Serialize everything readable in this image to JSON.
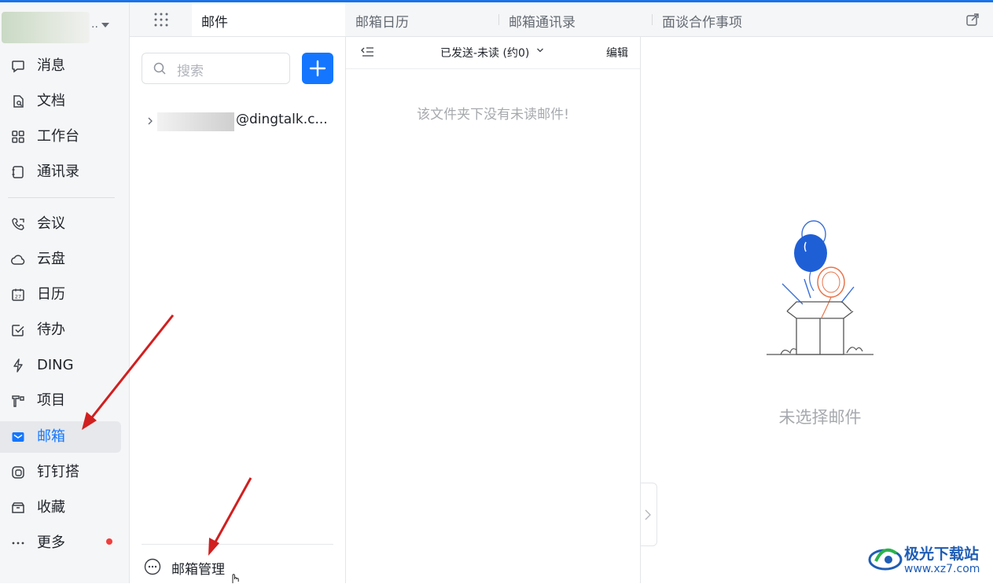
{
  "sidebar": {
    "profile_suffix": "..",
    "items": [
      {
        "label": "消息",
        "icon": "chat-bubble-icon"
      },
      {
        "label": "文档",
        "icon": "document-icon"
      },
      {
        "label": "工作台",
        "icon": "grid-icon"
      },
      {
        "label": "通讯录",
        "icon": "contacts-book-icon"
      },
      {
        "label": "会议",
        "icon": "phone-video-icon"
      },
      {
        "label": "云盘",
        "icon": "cloud-icon"
      },
      {
        "label": "日历",
        "icon": "calendar-icon",
        "day": "27"
      },
      {
        "label": "待办",
        "icon": "checkbox-icon"
      },
      {
        "label": "DING",
        "icon": "lightning-icon"
      },
      {
        "label": "项目",
        "icon": "project-icon"
      },
      {
        "label": "邮箱",
        "icon": "mail-icon",
        "active": true
      },
      {
        "label": "钉钉搭",
        "icon": "app-builder-icon"
      },
      {
        "label": "收藏",
        "icon": "box-icon"
      },
      {
        "label": "更多",
        "icon": "more-dots-icon",
        "badge": "red-dot"
      }
    ]
  },
  "tabs": [
    {
      "label": "邮件",
      "active": true
    },
    {
      "label": "邮箱日历"
    },
    {
      "label": "邮箱通讯录"
    },
    {
      "label": "面谈合作事项"
    }
  ],
  "folders": {
    "search_placeholder": "搜索",
    "account_email": "@dingtalk.c...",
    "manage_label": "邮箱管理"
  },
  "mail_list": {
    "folder_title": "已发送-未读 (约0)",
    "edit_label": "编辑",
    "empty_message": "该文件夹下没有未读邮件!"
  },
  "reading_pane": {
    "placeholder": "未选择邮件"
  },
  "watermark": {
    "title": "极光下载站",
    "url": "www.xz7.com"
  },
  "colors": {
    "accent": "#1476ff",
    "sidebar_bg": "#f5f6f7",
    "active_item_bg": "#e6e8eb",
    "annotation_arrow": "#d11f1f",
    "badge": "#f03e3e"
  }
}
